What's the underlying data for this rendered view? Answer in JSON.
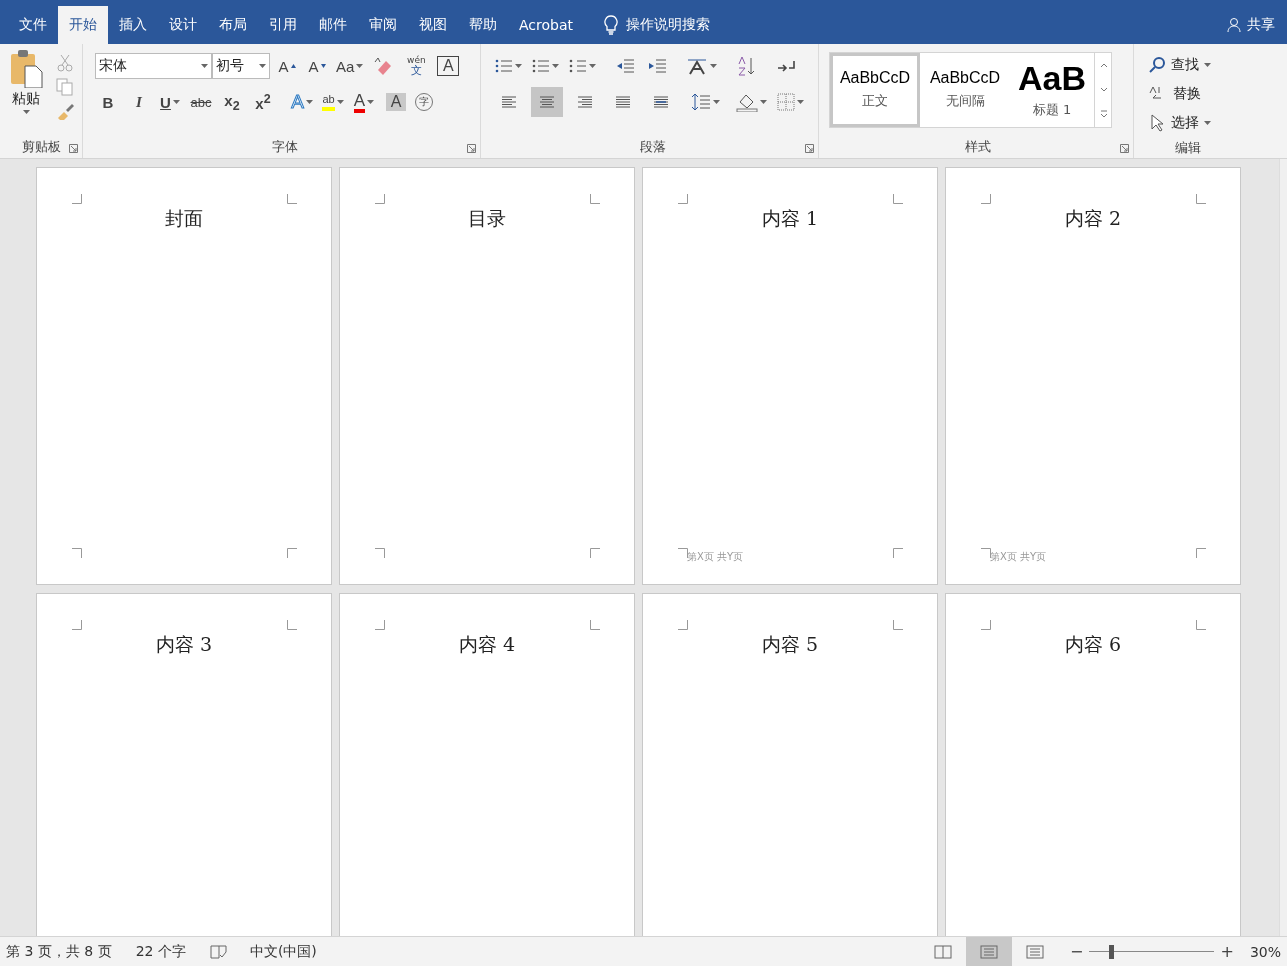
{
  "tabs": [
    {
      "label": "文件",
      "selected": false
    },
    {
      "label": "开始",
      "selected": true
    },
    {
      "label": "插入",
      "selected": false
    },
    {
      "label": "设计",
      "selected": false
    },
    {
      "label": "布局",
      "selected": false
    },
    {
      "label": "引用",
      "selected": false
    },
    {
      "label": "邮件",
      "selected": false
    },
    {
      "label": "审阅",
      "selected": false
    },
    {
      "label": "视图",
      "selected": false
    },
    {
      "label": "帮助",
      "selected": false
    },
    {
      "label": "Acrobat",
      "selected": false
    }
  ],
  "tell_me": "操作说明搜索",
  "share": "共享",
  "clipboard": {
    "paste": "粘贴",
    "group": "剪贴板"
  },
  "font": {
    "name": "宋体",
    "size": "初号",
    "group": "字体",
    "row1": [
      {
        "kind": "grow",
        "label": "A"
      },
      {
        "kind": "shrink",
        "label": "A"
      },
      {
        "kind": "case",
        "label": "Aa"
      },
      {
        "kind": "clear"
      },
      {
        "kind": "phonetic",
        "label": "wén",
        "sub": "文"
      },
      {
        "kind": "border",
        "label": "A"
      }
    ],
    "row2": [
      {
        "kind": "bold",
        "label": "B"
      },
      {
        "kind": "italic",
        "label": "I"
      },
      {
        "kind": "underline",
        "label": "U"
      },
      {
        "kind": "strike",
        "label": "abc"
      },
      {
        "kind": "script",
        "label": "x$_{2}$"
      },
      {
        "kind": "script",
        "label": "x$^{2}$"
      },
      {
        "kind": "effects",
        "label": "A"
      },
      {
        "kind": "highlight",
        "label": "ab"
      },
      {
        "kind": "color",
        "label": "A"
      },
      {
        "kind": "shade",
        "label": "A"
      },
      {
        "kind": "enclose",
        "label": "字"
      }
    ]
  },
  "paragraph": {
    "group": "段落",
    "align": [
      {
        "kind": "left",
        "selected": false
      },
      {
        "kind": "center",
        "selected": true
      },
      {
        "kind": "right",
        "selected": false
      },
      {
        "kind": "justify",
        "selected": false
      },
      {
        "kind": "distribute",
        "selected": false
      }
    ]
  },
  "styles": {
    "group": "样式",
    "items": [
      {
        "preview": "AaBbCcD",
        "name": "正文",
        "kind": "normal",
        "selected": true
      },
      {
        "preview": "AaBbCcD",
        "name": "无间隔",
        "kind": "normal",
        "selected": false
      },
      {
        "preview": "AaB",
        "name": "标题 1",
        "kind": "heading",
        "selected": false
      }
    ]
  },
  "editing": {
    "group": "编辑",
    "find": "查找",
    "replace": "替换",
    "select": "选择"
  },
  "pages": [
    {
      "title": "封面"
    },
    {
      "title": "目录"
    },
    {
      "title": "内容 1",
      "footer": "第X页 共Y页"
    },
    {
      "title": "内容 2",
      "footer": "第X页 共Y页"
    },
    {
      "title": "内容 3"
    },
    {
      "title": "内容 4"
    },
    {
      "title": "内容 5"
    },
    {
      "title": "内容 6"
    }
  ],
  "status": {
    "page": "第 3 页，共 8 页",
    "words": "22 个字",
    "language": "中文(中国)",
    "views": [
      {
        "kind": "read",
        "selected": false
      },
      {
        "kind": "print",
        "selected": true
      },
      {
        "kind": "web",
        "selected": false
      }
    ],
    "zoom_slider": {
      "level": 0.17
    },
    "zoom": "30%",
    "minus": "−",
    "plus": "+"
  }
}
